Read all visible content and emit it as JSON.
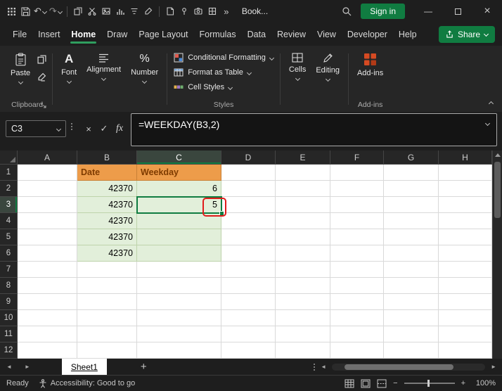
{
  "colors": {
    "excel_green": "#107C41",
    "home_underline_green": "#2f9e5f",
    "titlebar_bg": "#1E1E1E",
    "ribbon_bg": "#262626",
    "orange_fill": "#ED9C4A",
    "orange_text": "#7E3B00",
    "green_fill": "#E2EFDA",
    "annotation_red": "#E01B1B",
    "addins_icon_orange": "#D64A22"
  },
  "icons": {
    "undo": "↶",
    "redo": "↷",
    "more_commands": "»",
    "minimize": "—",
    "close": "×",
    "font": "A",
    "percent": "%",
    "nav_left": "◄",
    "nav_right": "►",
    "add": "+",
    "zoom_out": "−",
    "zoom_in": "+",
    "cancel": "×",
    "enter": "✓"
  },
  "title_bar": {
    "document_title": "Book...",
    "sign_in": "Sign in"
  },
  "menu_bar": {
    "items": [
      {
        "label": "File"
      },
      {
        "label": "Insert"
      },
      {
        "label": "Home"
      },
      {
        "label": "Draw"
      },
      {
        "label": "Page Layout"
      },
      {
        "label": "Formulas"
      },
      {
        "label": "Data"
      },
      {
        "label": "Review"
      },
      {
        "label": "View"
      },
      {
        "label": "Developer"
      },
      {
        "label": "Help"
      }
    ],
    "share": "Share"
  },
  "ribbon": {
    "paste": "Paste",
    "clipboard_group": "Clipboard",
    "font": "Font",
    "alignment": "Alignment",
    "number": "Number",
    "conditional_formatting": "Conditional Formatting",
    "format_as_table": "Format as Table",
    "cell_styles": "Cell Styles",
    "styles_group": "Styles",
    "cells": "Cells",
    "editing": "Editing",
    "add_ins": "Add-ins",
    "add_ins_group": "Add-ins"
  },
  "formula_bar": {
    "name_box": "C3",
    "fx": "fx",
    "formula": "=WEEKDAY(B3,2)"
  },
  "grid": {
    "columns": [
      "A",
      "B",
      "C",
      "D",
      "E",
      "F",
      "G",
      "H"
    ],
    "rows": [
      "1",
      "2",
      "3",
      "4",
      "5",
      "6",
      "7",
      "8",
      "9",
      "10",
      "11",
      "12"
    ],
    "selected_cell": "C3",
    "table": {
      "date_header": "Date",
      "weekday_header": "Weekday",
      "rows": [
        {
          "date": "42370",
          "weekday": "6"
        },
        {
          "date": "42370",
          "weekday": "5"
        },
        {
          "date": "42370",
          "weekday": ""
        },
        {
          "date": "42370",
          "weekday": ""
        },
        {
          "date": "42370",
          "weekday": ""
        }
      ]
    }
  },
  "sheet_bar": {
    "tabs": [
      {
        "label": "Sheet1"
      }
    ]
  },
  "status_bar": {
    "ready": "Ready",
    "accessibility": "Accessibility: Good to go",
    "zoom": "100%"
  }
}
